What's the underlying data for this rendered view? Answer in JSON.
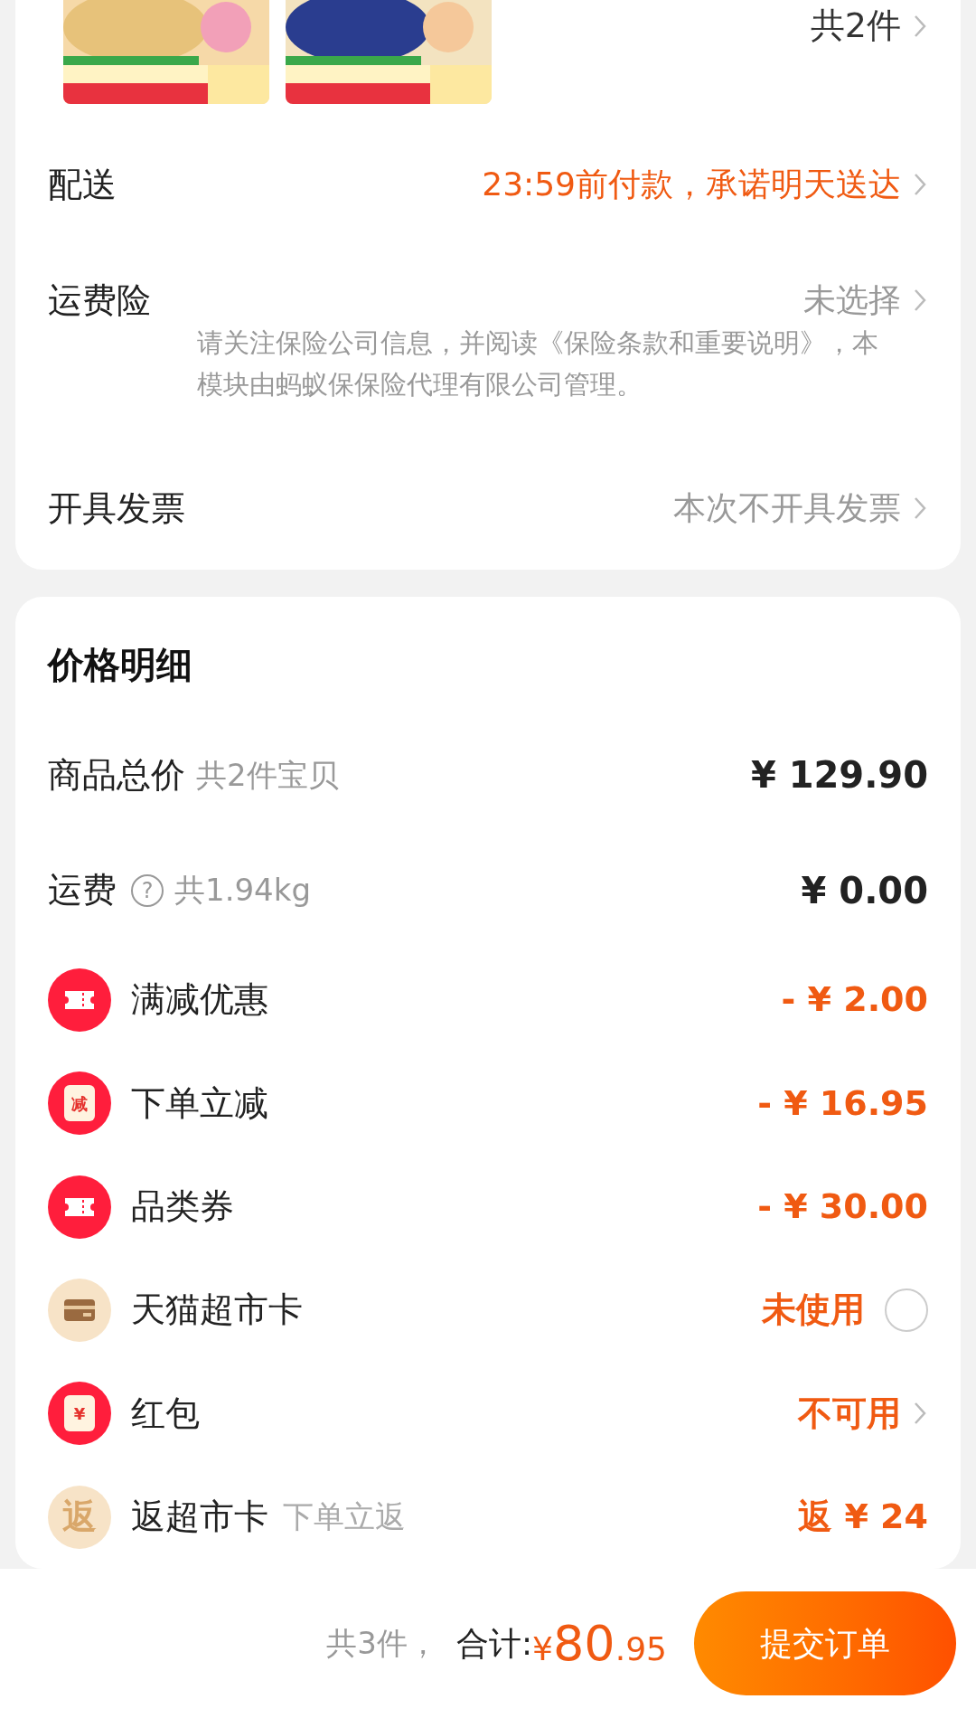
{
  "order_card": {
    "count": "共2件",
    "rows": [
      {
        "label": "配送",
        "value": "23:59前付款，承诺明天送达",
        "highlight": true
      },
      {
        "label": "运费险",
        "value": "未选择",
        "highlight": false,
        "note": "请关注保险公司信息，并阅读《保险条款和重要说明》，本模块由蚂蚁保保险代理有限公司管理。"
      },
      {
        "label": "开具发票",
        "value": "本次不开具发票",
        "highlight": false
      }
    ]
  },
  "price_detail": {
    "title": "价格明细",
    "rows": [
      {
        "kind": "plain",
        "label": "商品总价",
        "note": "共2件宝贝",
        "amount": "¥ 129.90"
      },
      {
        "kind": "plain",
        "label": "运费",
        "help": "?",
        "note": "共1.94kg",
        "amount": "¥ 0.00"
      },
      {
        "kind": "ticket",
        "label": "满减优惠",
        "amount": "- ¥ 2.00"
      },
      {
        "kind": "tag",
        "icon_text": "减",
        "label": "下单立减",
        "amount": "- ¥ 16.95"
      },
      {
        "kind": "ticket",
        "label": "品类券",
        "amount": "- ¥ 30.00"
      },
      {
        "kind": "card",
        "label": "天猫超市卡",
        "amount": "未使用",
        "checked": false
      },
      {
        "kind": "tag",
        "icon_text": "¥",
        "label": "红包",
        "amount": "不可用",
        "link": true
      },
      {
        "kind": "rebate",
        "icon_text": "返",
        "label": "返超市卡",
        "note": "下单立返",
        "amount": "返 ¥ 24"
      }
    ]
  },
  "footer": {
    "count": "共3件，",
    "total_label": "合计:",
    "currency": "¥",
    "total_int": "80",
    "total_dec": ".95",
    "submit": "提交订单"
  }
}
